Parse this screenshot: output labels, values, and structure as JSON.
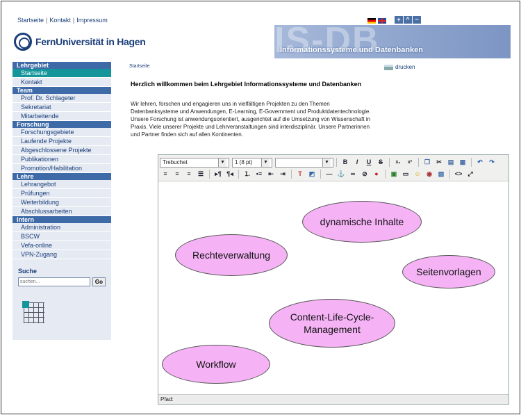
{
  "header": {
    "top_links": [
      "Startseite",
      "Kontakt",
      "Impressum"
    ],
    "logo_text": "FernUniversität in Hagen",
    "banner_big": "IS-DB",
    "banner_subtitle": "Informationssysteme und Datenbanken",
    "font_controls": [
      "+",
      "^",
      "−"
    ]
  },
  "sidebar": {
    "sections": [
      {
        "title": "Lehrgebiet",
        "items": [
          "Startseite",
          "Kontakt"
        ]
      },
      {
        "title": "Team",
        "items": [
          "Prof. Dr. Schlageter",
          "Sekretariat",
          "Mitarbeitende"
        ]
      },
      {
        "title": "Forschung",
        "items": [
          "Forschungsgebiete",
          "Laufende Projekte",
          "Abgeschlossene Projekte",
          "Publikationen",
          "Promotion/Habilitation"
        ]
      },
      {
        "title": "Lehre",
        "items": [
          "Lehrangebot",
          "Prüfungen",
          "Weiterbildung",
          "Abschlussarbeiten"
        ]
      },
      {
        "title": "Intern",
        "items": [
          "Administration",
          "BSCW",
          "Vefa-online",
          "VPN-Zugang"
        ]
      }
    ],
    "active_item": "Startseite",
    "search": {
      "title": "Suche",
      "placeholder": "suchen...",
      "button": "Go"
    }
  },
  "main": {
    "breadcrumb": "Startseite",
    "print_label": "drucken",
    "title": "Herzlich willkommen beim Lehrgebiet Informationssysteme und Datenbanken",
    "intro_lines": [
      "Wir lehren, forschen und engagieren uns in vielfältigen Projekten zu den Themen",
      "Datenbanksysteme und Anwendungen, E-Learning, E-Government und Produktdatentechnologie.",
      "Unsere Forschung ist anwendungsorientiert, ausgerichtet auf die Umsetzung von Wissenschaft in",
      "Praxis. Viele unserer Projekte und Lehrveranstaltungen sind interdisziplinär. Unsere Partnerinnen",
      "und Partner finden sich auf allen Kontinenten."
    ]
  },
  "editor": {
    "font_select": "Trebuchet",
    "size_select": "1 (8 pt)",
    "style_select": "",
    "path_label": "Pfad:",
    "bubbles": [
      "dynamische Inhalte",
      "Rechteverwaltung",
      "Seitenvorlagen",
      "Content-Life-Cycle-\nManagement",
      "Workflow"
    ]
  },
  "colors": {
    "brand_blue": "#1b3f79",
    "section_blue": "#3f6aa8",
    "active_teal": "#13959a",
    "bubble_pink": "#f5b3f5"
  }
}
